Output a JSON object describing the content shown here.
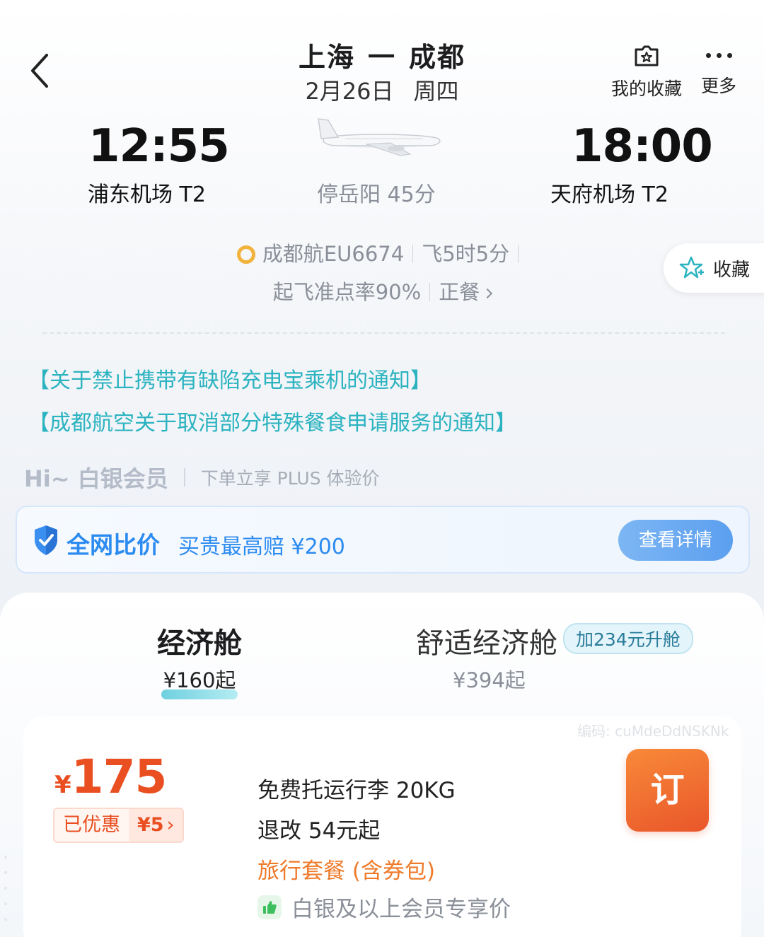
{
  "header": {
    "origin": "上海",
    "dash": "一",
    "destination": "成都",
    "date": "2月26日",
    "weekday": "周四",
    "favorites_label": "我的收藏",
    "more_label": "更多"
  },
  "flight": {
    "dep_time": "12:55",
    "dep_airport": "浦东机场 T2",
    "arr_time": "18:00",
    "arr_airport": "天府机场 T2",
    "stopover": "停岳阳 45分",
    "airline_flight": "成都航EU6674",
    "duration": "飞5时5分",
    "ontime_rate": "起飞准点率90%",
    "meal": "正餐"
  },
  "side_favorite_label": "收藏",
  "notices": [
    "【关于禁止携带有缺陷充电宝乘机的通知】",
    "【成都航空关于取消部分特殊餐食申请服务的通知】"
  ],
  "member": {
    "greeting": "Hi~ 白银会员",
    "benefit": "下单立享 PLUS 体验价"
  },
  "price_compare": {
    "title": "全网比价",
    "desc": "买贵最高赔 ¥200",
    "button": "查看详情"
  },
  "cabins": {
    "economy": {
      "name": "经济舱",
      "price": "¥160起"
    },
    "comfort": {
      "name": "舒适经济舱",
      "upgrade": "加234元升舱",
      "price": "¥394起"
    }
  },
  "fare": {
    "code": "编码: cuMdeDdNSKNk",
    "currency": "¥",
    "price": "175",
    "discount_label": "已优惠",
    "discount_value": "¥5",
    "baggage": "免费托运行李 20KG",
    "change": "退改 54元起",
    "package": "旅行套餐 (含券包)",
    "member_only": "白银及以上会员专享价",
    "book": "订"
  },
  "colors": {
    "teal_link": "#2bb3c0",
    "blue": "#2c8bf0",
    "price_red": "#e94f21",
    "book_orange": "#f07a33",
    "package_orange": "#ee7a2a"
  }
}
